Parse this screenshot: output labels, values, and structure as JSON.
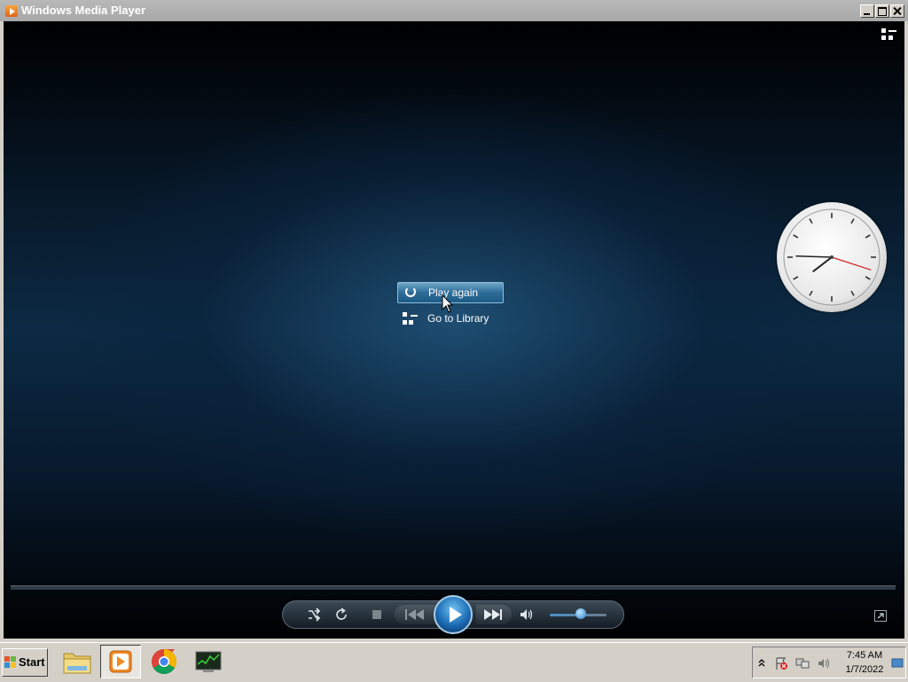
{
  "window": {
    "title": "Windows Media Player"
  },
  "overlay": {
    "play_again_label": "Play again",
    "library_label": "Go to Library"
  },
  "player": {
    "volume_level": 0.55,
    "accent_color": "#1c6cb4"
  },
  "clock_gadget": {
    "hour": 7,
    "minute": 45,
    "second": 18
  },
  "taskbar": {
    "start_label": "Start",
    "apps": [
      "file-explorer-icon",
      "windows-media-player-icon",
      "chrome-icon",
      "task-manager-icon"
    ],
    "tray": {
      "time": "7:45 AM",
      "date": "1/7/2022"
    }
  }
}
